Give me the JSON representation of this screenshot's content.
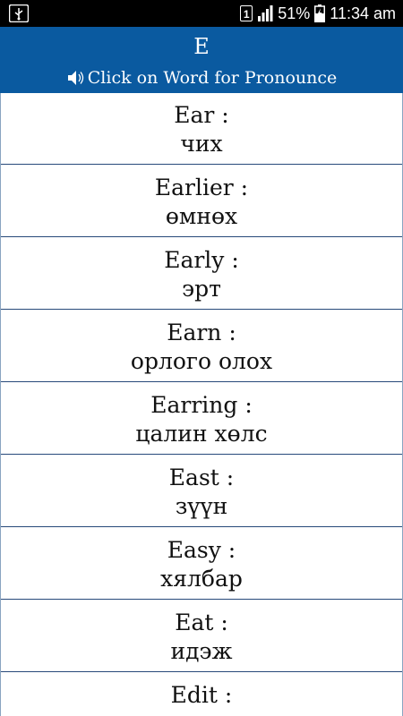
{
  "status_bar": {
    "sim": "1",
    "battery_percent": "51%",
    "time": "11:34 am"
  },
  "header": {
    "letter": "E",
    "hint": "Click on Word for Pronounce",
    "background_color": "#0a5aa0"
  },
  "words": [
    {
      "en": "Ear :",
      "mn": "чих"
    },
    {
      "en": "Earlier :",
      "mn": "өмнөх"
    },
    {
      "en": "Early :",
      "mn": "эрт"
    },
    {
      "en": "Earn :",
      "mn": "орлого олох"
    },
    {
      "en": "Earring :",
      "mn": "цалин хөлс"
    },
    {
      "en": "East :",
      "mn": "зүүн"
    },
    {
      "en": "Easy :",
      "mn": "хялбар"
    },
    {
      "en": "Eat :",
      "mn": "идэж"
    },
    {
      "en": "Edit :",
      "mn": ""
    }
  ]
}
